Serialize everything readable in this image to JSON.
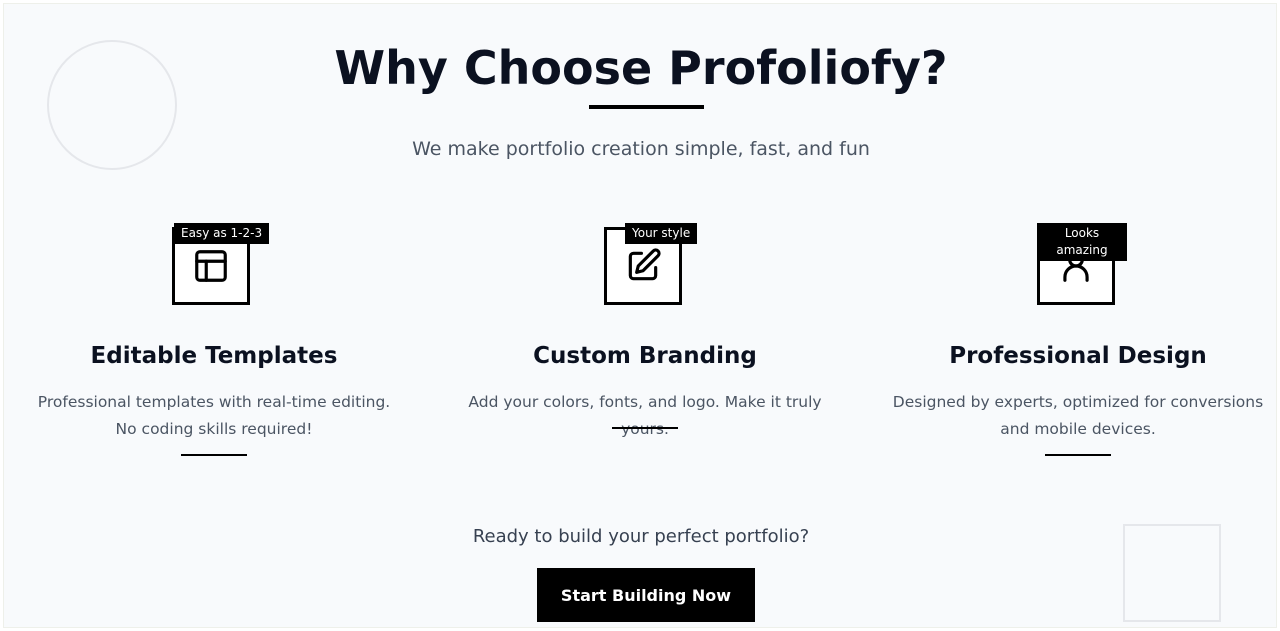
{
  "heading": {
    "title": "Why Choose Profoliofy?",
    "subtitle": "We make portfolio creation simple, fast, and fun"
  },
  "features": [
    {
      "badge": "Easy as 1-2-3",
      "icon": "layout-template-icon",
      "title": "Editable Templates",
      "description": "Professional templates with real-time editing. No coding skills required!"
    },
    {
      "badge": "Your style",
      "icon": "edit-square-icon",
      "title": "Custom Branding",
      "description": "Add your colors, fonts, and logo. Make it truly yours."
    },
    {
      "badge": "Looks amazing",
      "icon": "user-icon",
      "title": "Professional Design",
      "description": "Designed by experts, optimized for conversions and mobile devices."
    }
  ],
  "cta": {
    "prompt": "Ready to build your perfect portfolio?",
    "button_label": "Start Building Now"
  },
  "colors": {
    "background": "#f8fafc",
    "accent": "#000000",
    "heading": "#0b1120",
    "body_text": "#4b5563"
  }
}
